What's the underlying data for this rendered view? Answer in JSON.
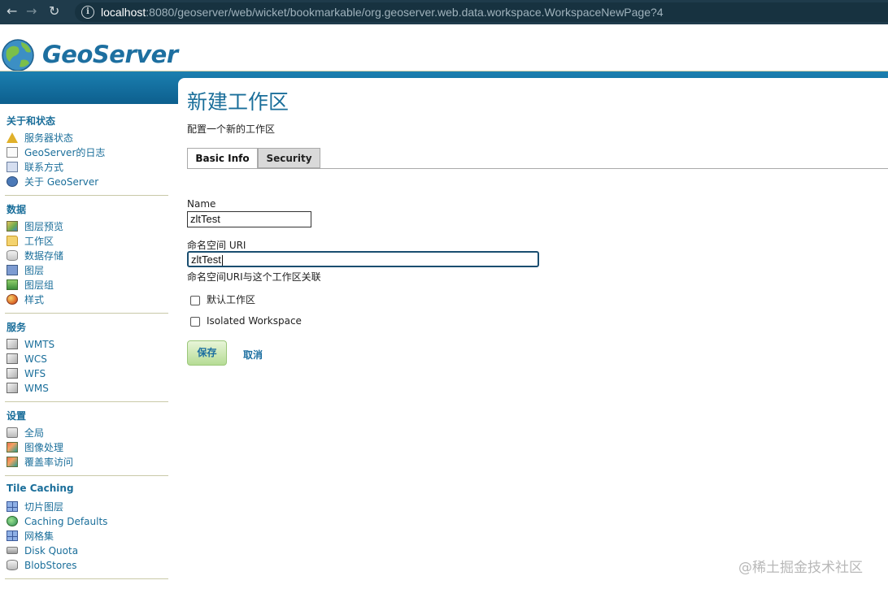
{
  "browser": {
    "url_host": "localhost",
    "url_rest": ":8080/geoserver/web/wicket/bookmarkable/org.geoserver.web.data.workspace.WorkspaceNewPage?4"
  },
  "header": {
    "logo_text": "GeoServer"
  },
  "sidebar": {
    "sections": [
      {
        "title": "关于和状态",
        "items": [
          {
            "label": "服务器状态",
            "icon": "server-status-icon"
          },
          {
            "label": "GeoServer的日志",
            "icon": "log-icon"
          },
          {
            "label": "联系方式",
            "icon": "contact-icon"
          },
          {
            "label": "关于 GeoServer",
            "icon": "about-icon"
          }
        ]
      },
      {
        "title": "数据",
        "items": [
          {
            "label": "图层预览",
            "icon": "layer-preview-icon"
          },
          {
            "label": "工作区",
            "icon": "folder-icon"
          },
          {
            "label": "数据存储",
            "icon": "database-icon"
          },
          {
            "label": "图层",
            "icon": "layer-icon"
          },
          {
            "label": "图层组",
            "icon": "layer-group-icon"
          },
          {
            "label": "样式",
            "icon": "style-icon"
          }
        ]
      },
      {
        "title": "服务",
        "items": [
          {
            "label": "WMTS",
            "icon": "service-icon"
          },
          {
            "label": "WCS",
            "icon": "service-icon"
          },
          {
            "label": "WFS",
            "icon": "service-icon"
          },
          {
            "label": "WMS",
            "icon": "service-icon"
          }
        ]
      },
      {
        "title": "设置",
        "items": [
          {
            "label": "全局",
            "icon": "global-icon"
          },
          {
            "label": "图像处理",
            "icon": "image-processing-icon"
          },
          {
            "label": "覆盖率访问",
            "icon": "coverage-access-icon"
          }
        ]
      },
      {
        "title": "Tile Caching",
        "items": [
          {
            "label": "切片图层",
            "icon": "tile-layers-icon"
          },
          {
            "label": "Caching Defaults",
            "icon": "caching-defaults-icon"
          },
          {
            "label": "网格集",
            "icon": "gridsets-icon"
          },
          {
            "label": "Disk Quota",
            "icon": "disk-quota-icon"
          },
          {
            "label": "BlobStores",
            "icon": "blobstores-icon"
          }
        ]
      }
    ]
  },
  "main": {
    "title": "新建工作区",
    "description": "配置一个新的工作区",
    "tabs": [
      {
        "label": "Basic Info",
        "active": true
      },
      {
        "label": "Security",
        "active": false
      }
    ],
    "name_label": "Name",
    "name_value": "zltTest",
    "uri_label": "命名空间 URI",
    "uri_value": "zltTest",
    "uri_hint": "命名空间URI与这个工作区关联",
    "default_checkbox_label": "默认工作区",
    "default_checked": false,
    "isolated_checkbox_label": "Isolated Workspace",
    "isolated_checked": false,
    "save_label": "保存",
    "cancel_label": "取消"
  },
  "watermark": "@稀土掘金技术社区"
}
